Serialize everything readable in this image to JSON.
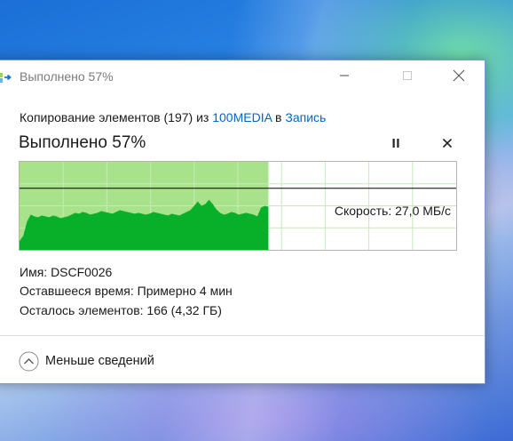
{
  "window": {
    "title": "Выполнено 57%",
    "minimize_icon": "minimize-icon",
    "maximize_icon": "maximize-icon",
    "close_icon": "close-icon"
  },
  "copy": {
    "prefix": "Копирование элементов (197) из",
    "source": "100MEDIA",
    "middle": "в",
    "destination": "Запись"
  },
  "status": {
    "percent_text": "Выполнено 57%",
    "progress_fraction": 0.57,
    "pause_icon": "pause-icon",
    "cancel_icon": "cancel-icon"
  },
  "graph": {
    "speed_label": "Скорость: 27,0 МБ/с",
    "speed_fraction_of_max": 0.7,
    "colors": {
      "done_fill": "#a8e38c",
      "throughput": "#08b02a",
      "grid": "#c9e9bb",
      "speed_line": "#000000"
    },
    "throughput_samples": [
      0.1,
      0.16,
      0.32,
      0.4,
      0.38,
      0.37,
      0.39,
      0.38,
      0.37,
      0.39,
      0.38,
      0.36,
      0.37,
      0.38,
      0.4,
      0.42,
      0.41,
      0.43,
      0.42,
      0.4,
      0.41,
      0.42,
      0.44,
      0.43,
      0.42,
      0.41,
      0.43,
      0.45,
      0.44,
      0.43,
      0.42,
      0.41,
      0.42,
      0.41,
      0.4,
      0.41,
      0.43,
      0.42,
      0.41,
      0.4,
      0.39,
      0.41,
      0.4,
      0.39,
      0.41,
      0.43,
      0.45,
      0.5,
      0.55,
      0.5,
      0.52,
      0.57,
      0.52,
      0.46,
      0.42,
      0.4,
      0.41,
      0.43,
      0.42,
      0.4,
      0.41,
      0.42,
      0.41,
      0.4,
      0.38,
      0.48,
      0.5,
      0.49
    ]
  },
  "info": {
    "name_label": "Имя:",
    "name_value": "DSCF0026",
    "time_label": "Оставшееся время:",
    "time_value": "Примерно 4 мин",
    "items_label": "Осталось элементов:",
    "items_value": "166 (4,32 ГБ)"
  },
  "details": {
    "label": "Меньше сведений",
    "icon": "chevron-up-circle-icon"
  }
}
